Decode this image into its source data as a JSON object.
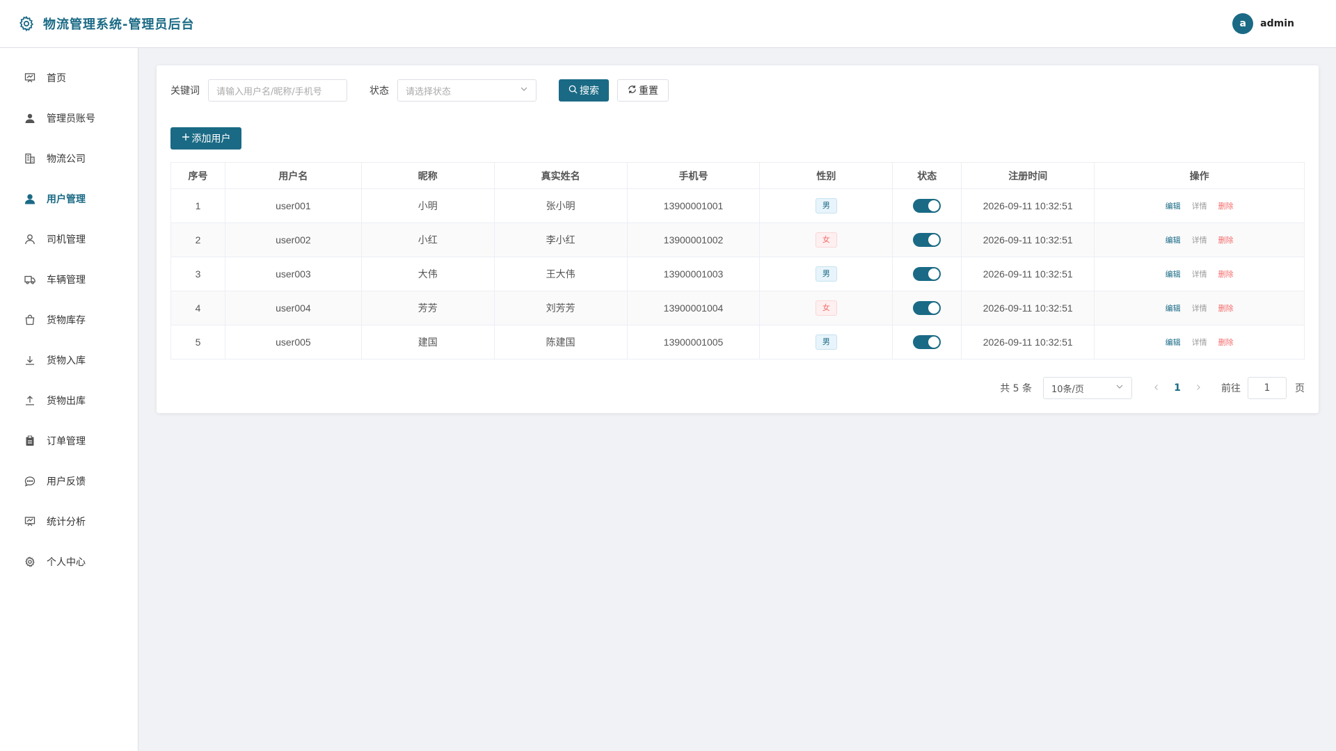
{
  "header": {
    "title": "物流管理系统-管理员后台",
    "avatar_letter": "a",
    "username": "admin"
  },
  "sidebar": {
    "items": [
      {
        "label": "首页",
        "icon": "dashboard-icon"
      },
      {
        "label": "管理员账号",
        "icon": "user-filled-icon"
      },
      {
        "label": "物流公司",
        "icon": "building-icon"
      },
      {
        "label": "用户管理",
        "icon": "user-filled-icon",
        "active": true
      },
      {
        "label": "司机管理",
        "icon": "user-icon"
      },
      {
        "label": "车辆管理",
        "icon": "truck-icon"
      },
      {
        "label": "货物库存",
        "icon": "bag-icon"
      },
      {
        "label": "货物入库",
        "icon": "download-icon"
      },
      {
        "label": "货物出库",
        "icon": "upload-icon"
      },
      {
        "label": "订单管理",
        "icon": "clipboard-icon"
      },
      {
        "label": "用户反馈",
        "icon": "chat-icon"
      },
      {
        "label": "统计分析",
        "icon": "chart-icon"
      },
      {
        "label": "个人中心",
        "icon": "gear-icon"
      }
    ]
  },
  "search": {
    "keyword_label": "关键词",
    "keyword_placeholder": "请输入用户名/昵称/手机号",
    "status_label": "状态",
    "status_placeholder": "请选择状态",
    "search_button": "搜索",
    "reset_button": "重置"
  },
  "add_button": "添加用户",
  "table": {
    "headers": [
      "序号",
      "用户名",
      "昵称",
      "真实姓名",
      "手机号",
      "性别",
      "状态",
      "注册时间",
      "操作"
    ],
    "rows": [
      {
        "no": "1",
        "username": "user001",
        "nickname": "小明",
        "realname": "张小明",
        "phone": "13900001001",
        "gender": "男",
        "status": true,
        "time": "2026-09-11 10:32:51"
      },
      {
        "no": "2",
        "username": "user002",
        "nickname": "小红",
        "realname": "李小红",
        "phone": "13900001002",
        "gender": "女",
        "status": true,
        "time": "2026-09-11 10:32:51"
      },
      {
        "no": "3",
        "username": "user003",
        "nickname": "大伟",
        "realname": "王大伟",
        "phone": "13900001003",
        "gender": "男",
        "status": true,
        "time": "2026-09-11 10:32:51"
      },
      {
        "no": "4",
        "username": "user004",
        "nickname": "芳芳",
        "realname": "刘芳芳",
        "phone": "13900001004",
        "gender": "女",
        "status": true,
        "time": "2026-09-11 10:32:51"
      },
      {
        "no": "5",
        "username": "user005",
        "nickname": "建国",
        "realname": "陈建国",
        "phone": "13900001005",
        "gender": "男",
        "status": true,
        "time": "2026-09-11 10:32:51"
      }
    ],
    "ops": {
      "edit": "编辑",
      "detail": "详情",
      "delete": "删除"
    }
  },
  "pagination": {
    "total_text": "共 5 条",
    "page_size": "10条/页",
    "current_page": "1",
    "goto_label": "前往",
    "goto_value": "1",
    "unit": "页"
  },
  "colors": {
    "accent": "#1a6a85",
    "danger": "#f56c6c"
  }
}
